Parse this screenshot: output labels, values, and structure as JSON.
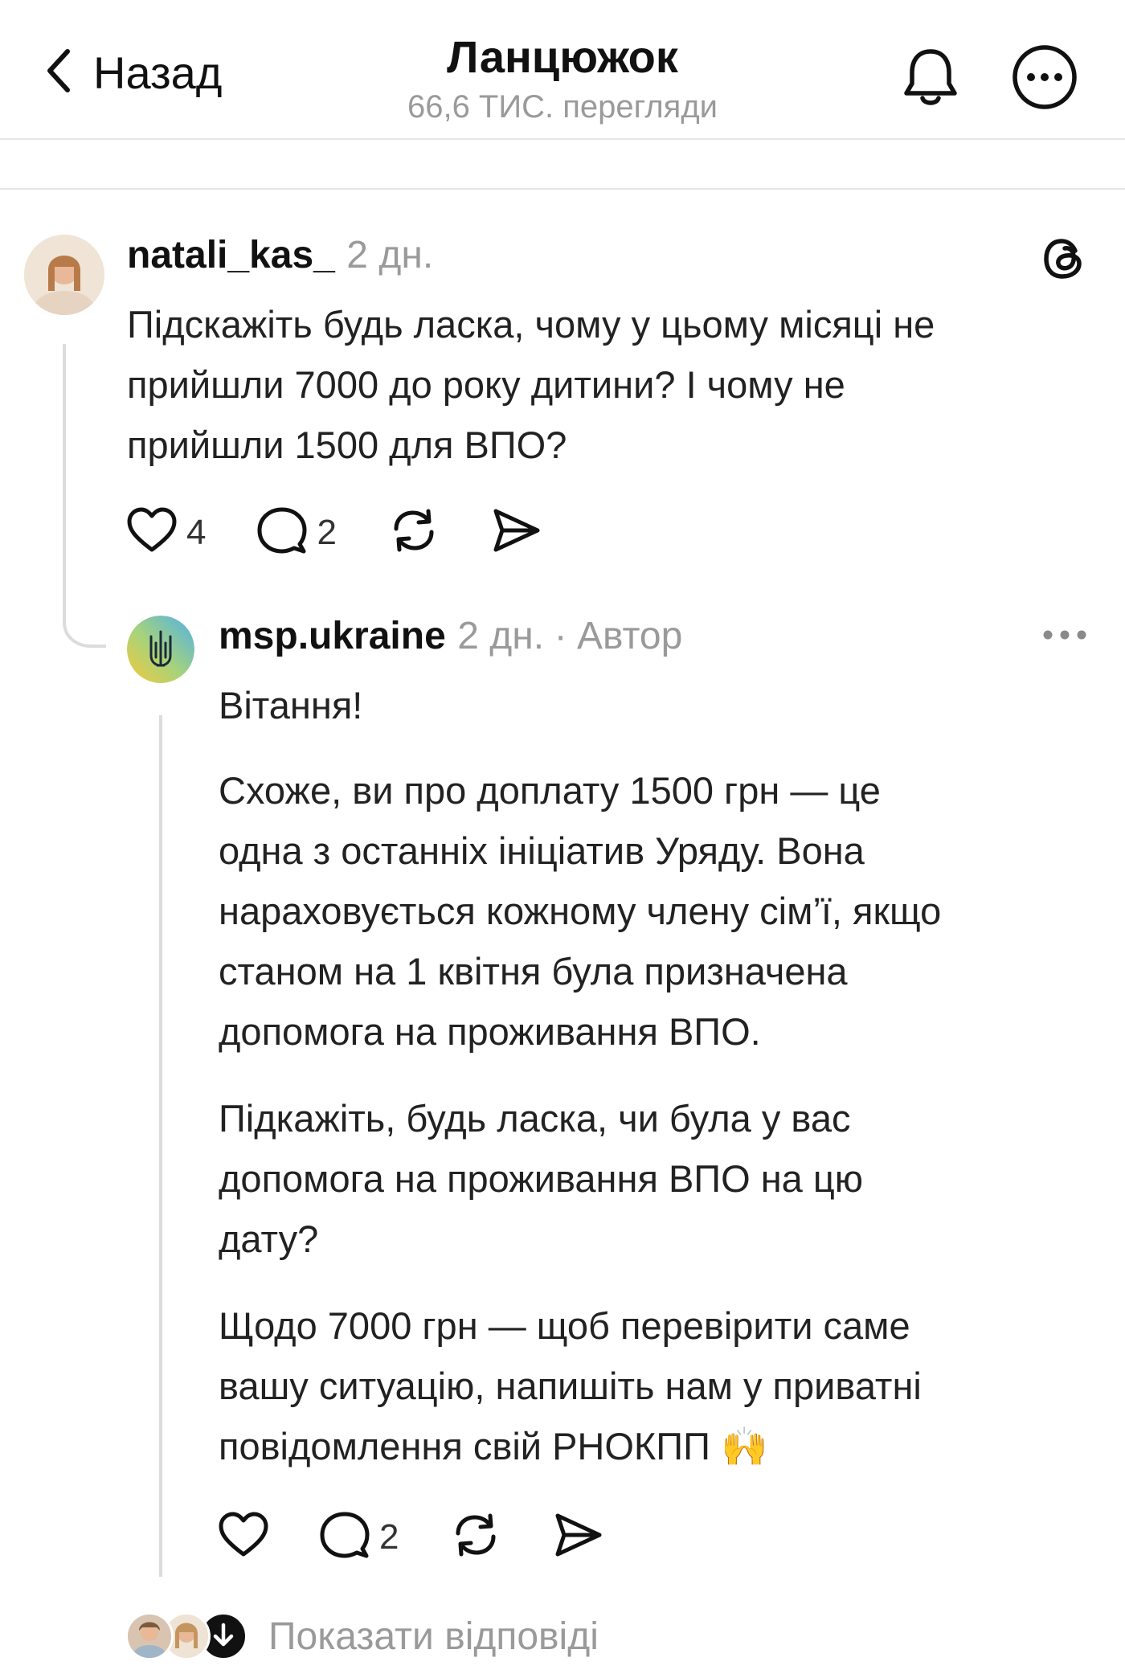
{
  "header": {
    "back_label": "Назад",
    "title": "Ланцюжок",
    "views": "66,6 ТИС. перегляди"
  },
  "post": {
    "username": "natali_kas_",
    "time": "2 дн.",
    "text_lines": [
      "Підскажіть будь ласка, чому у цьому місяці не",
      "прийшли 7000 до року дитини? І чому не",
      "прийшли 1500 для ВПО?"
    ],
    "likes": "4",
    "replies": "2"
  },
  "reply": {
    "username": "msp.ukraine",
    "time": "2 дн.",
    "separator": "·",
    "author_label": "Автор",
    "greeting": "Вітання!",
    "paragraph1": [
      "Схоже, ви про доплату 1500 грн — це",
      "одна з останніх ініціатив Уряду. Вона",
      "нараховується кожному члену сім’ї, якщо",
      "станом на 1 квітня була призначена",
      "допомога на проживання ВПО."
    ],
    "paragraph2": [
      "Підкажіть, будь ласка, чи була у вас",
      "допомога на проживання ВПО на цю",
      "дату?"
    ],
    "paragraph3": [
      "Щодо 7000 грн — щоб перевірити саме",
      "вашу ситуацію, напишіть нам у приватні",
      "повідомлення свій РНОКПП"
    ],
    "emoji": "🙌",
    "replies": "2"
  },
  "footer": {
    "show_replies": "Показати відповіді"
  },
  "colors": {
    "text": "#111111",
    "muted": "#9a9a9a",
    "line": "#dcdcdc"
  }
}
